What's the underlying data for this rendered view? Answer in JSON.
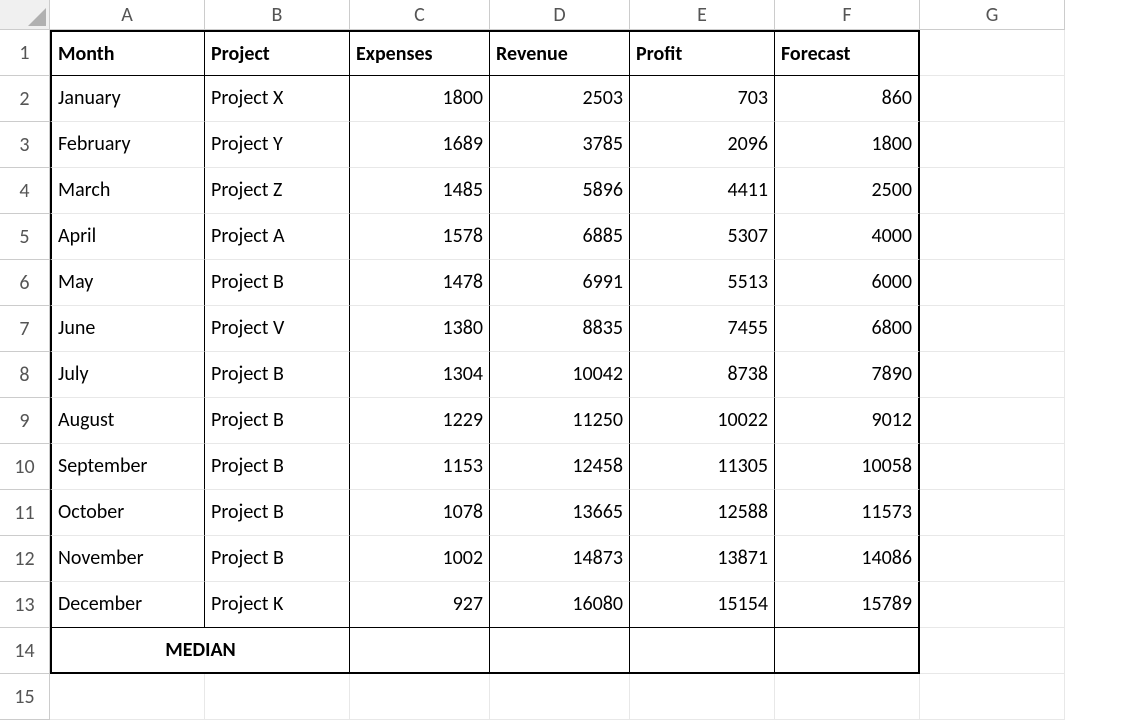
{
  "columns": [
    "A",
    "B",
    "C",
    "D",
    "E",
    "F",
    "G"
  ],
  "rowCount": 15,
  "headers": {
    "A": "Month",
    "B": "Project",
    "C": "Expenses",
    "D": "Revenue",
    "E": "Profit",
    "F": "Forecast"
  },
  "rows": [
    {
      "month": "January",
      "project": "Project X",
      "expenses": "1800",
      "revenue": "2503",
      "profit": "703",
      "forecast": "860"
    },
    {
      "month": "February",
      "project": "Project Y",
      "expenses": "1689",
      "revenue": "3785",
      "profit": "2096",
      "forecast": "1800"
    },
    {
      "month": "March",
      "project": "Project Z",
      "expenses": "1485",
      "revenue": "5896",
      "profit": "4411",
      "forecast": "2500"
    },
    {
      "month": "April",
      "project": "Project A",
      "expenses": "1578",
      "revenue": "6885",
      "profit": "5307",
      "forecast": "4000"
    },
    {
      "month": "May",
      "project": "Project B",
      "expenses": "1478",
      "revenue": "6991",
      "profit": "5513",
      "forecast": "6000"
    },
    {
      "month": "June",
      "project": "Project V",
      "expenses": "1380",
      "revenue": "8835",
      "profit": "7455",
      "forecast": "6800"
    },
    {
      "month": "July",
      "project": "Project B",
      "expenses": "1304",
      "revenue": "10042",
      "profit": "8738",
      "forecast": "7890"
    },
    {
      "month": "August",
      "project": "Project B",
      "expenses": "1229",
      "revenue": "11250",
      "profit": "10022",
      "forecast": "9012"
    },
    {
      "month": "September",
      "project": "Project B",
      "expenses": "1153",
      "revenue": "12458",
      "profit": "11305",
      "forecast": "10058"
    },
    {
      "month": "October",
      "project": "Project B",
      "expenses": "1078",
      "revenue": "13665",
      "profit": "12588",
      "forecast": "11573"
    },
    {
      "month": "November",
      "project": "Project B",
      "expenses": "1002",
      "revenue": "14873",
      "profit": "13871",
      "forecast": "14086"
    },
    {
      "month": "December",
      "project": "Project K",
      "expenses": "927",
      "revenue": "16080",
      "profit": "15154",
      "forecast": "15789"
    }
  ],
  "medianLabel": "MEDIAN"
}
